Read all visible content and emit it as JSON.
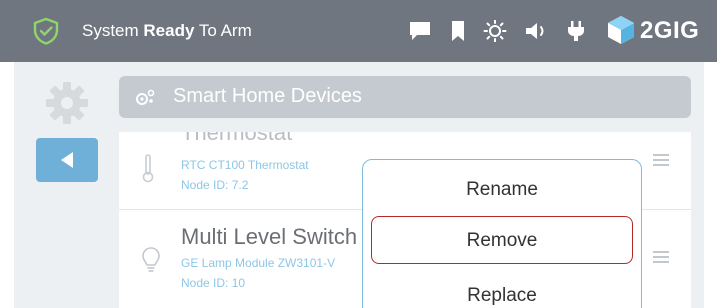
{
  "status_bar": {
    "status_prefix": "System ",
    "status_bold": "Ready",
    "status_suffix": " To Arm",
    "icons": [
      "shield-check-icon",
      "message-icon",
      "bookmark-icon",
      "brightness-icon",
      "volume-icon",
      "power-plug-icon"
    ],
    "brand": "2GIG",
    "colors": {
      "bar": "#6f7680",
      "shield": "#8ed66a"
    }
  },
  "section": {
    "title": "Smart Home Devices",
    "icon": "smart-home-icon"
  },
  "devices": [
    {
      "title": "Thermostat",
      "model": "RTC CT100 Thermostat",
      "node": "Node ID: 7.2",
      "icon": "thermometer-icon"
    },
    {
      "title": "Multi Level Switch",
      "model": "GE Lamp Module ZW3101-V",
      "node": "Node ID: 10",
      "icon": "lightbulb-icon"
    }
  ],
  "context_menu": {
    "items": [
      "Rename",
      "Remove",
      "Replace"
    ],
    "highlighted": "Remove"
  },
  "colors": {
    "accent_blue": "#6fb0d8",
    "highlight_red": "#b22a2a"
  }
}
